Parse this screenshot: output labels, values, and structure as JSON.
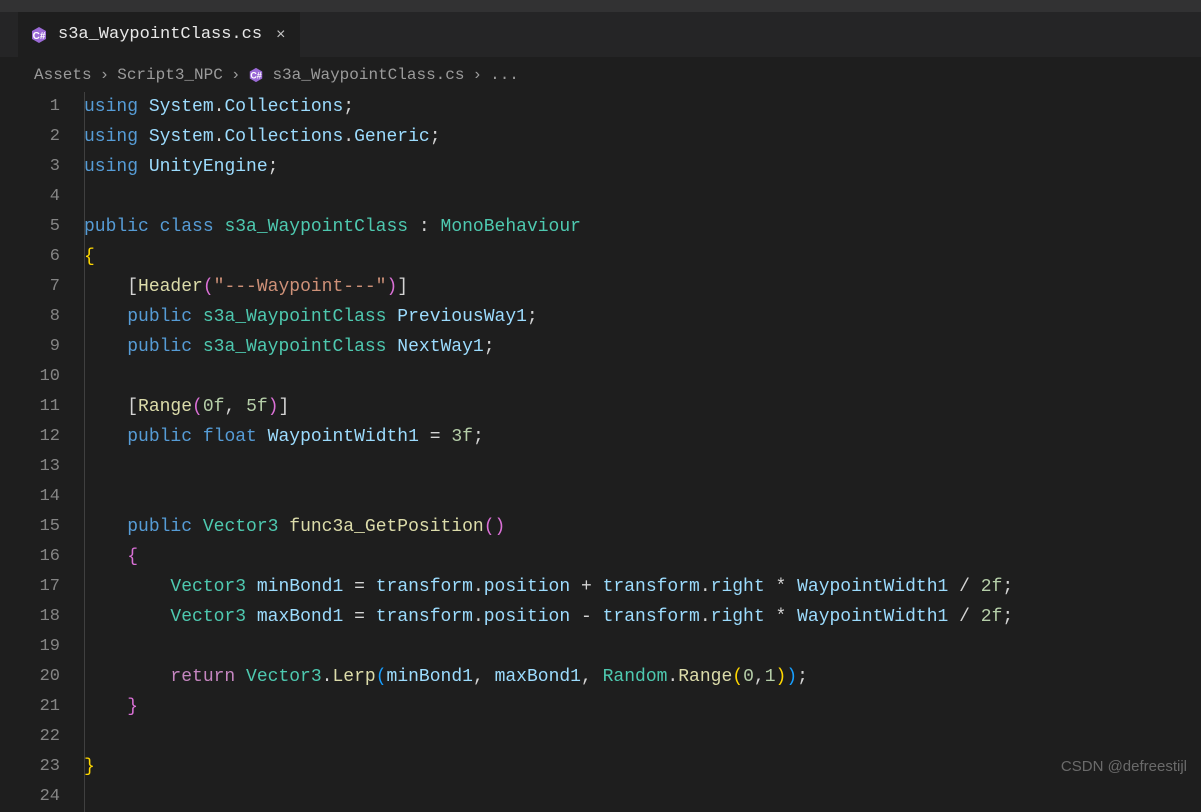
{
  "tab": {
    "label": "s3a_WaypointClass.cs",
    "close": "×"
  },
  "breadcrumbs": {
    "item1": "Assets",
    "item2": "Script3_NPC",
    "item3": "s3a_WaypointClass.cs",
    "item4": "..."
  },
  "lines": {
    "1": "1",
    "2": "2",
    "3": "3",
    "4": "4",
    "5": "5",
    "6": "6",
    "7": "7",
    "8": "8",
    "9": "9",
    "10": "10",
    "11": "11",
    "12": "12",
    "13": "13",
    "14": "14",
    "15": "15",
    "16": "16",
    "17": "17",
    "18": "18",
    "19": "19",
    "20": "20",
    "21": "21",
    "22": "22",
    "23": "23",
    "24": "24"
  },
  "code": {
    "l1": {
      "kw1": "using",
      "ns1": "System",
      "ns2": "Collections"
    },
    "l2": {
      "kw1": "using",
      "ns1": "System",
      "ns2": "Collections",
      "ns3": "Generic"
    },
    "l3": {
      "kw1": "using",
      "ns1": "UnityEngine"
    },
    "l5": {
      "kw1": "public",
      "kw2": "class",
      "cls": "s3a_WaypointClass",
      "base": "MonoBehaviour"
    },
    "l7": {
      "attr": "Header",
      "str": "\"---Waypoint---\""
    },
    "l8": {
      "kw1": "public",
      "type": "s3a_WaypointClass",
      "var": "PreviousWay1"
    },
    "l9": {
      "kw1": "public",
      "type": "s3a_WaypointClass",
      "var": "NextWay1"
    },
    "l11": {
      "attr": "Range",
      "n1": "0f",
      "n2": "5f"
    },
    "l12": {
      "kw1": "public",
      "kw2": "float",
      "var": "WaypointWidth1",
      "val": "3f"
    },
    "l15": {
      "kw1": "public",
      "type": "Vector3",
      "fn": "func3a_GetPosition"
    },
    "l17": {
      "type": "Vector3",
      "var": "minBond1",
      "t1": "transform",
      "p1": "position",
      "t2": "transform",
      "p2": "right",
      "v2": "WaypointWidth1",
      "n": "2f"
    },
    "l18": {
      "type": "Vector3",
      "var": "maxBond1",
      "t1": "transform",
      "p1": "position",
      "t2": "transform",
      "p2": "right",
      "v2": "WaypointWidth1",
      "n": "2f"
    },
    "l20": {
      "kw": "return",
      "type": "Vector3",
      "fn": "Lerp",
      "a1": "minBond1",
      "a2": "maxBond1",
      "rnd": "Random",
      "rfn": "Range",
      "n1": "0",
      "n2": "1"
    }
  },
  "watermark": "CSDN @defreestijl"
}
